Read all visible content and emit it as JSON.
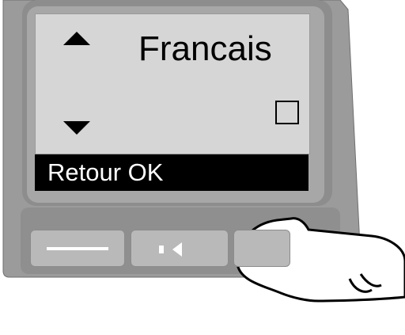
{
  "display": {
    "language": "Francais",
    "softkeys": "Retour OK",
    "checkbox": "unchecked"
  },
  "icons": {
    "up": "up-arrow-icon",
    "down": "down-arrow-icon",
    "speaker": "speaker-icon",
    "finger": "finger-icon"
  },
  "colors": {
    "bezel": "#9b9b9b",
    "screen_bg": "#d6d6d6",
    "softbar_bg": "#000000",
    "text": "#000000"
  }
}
